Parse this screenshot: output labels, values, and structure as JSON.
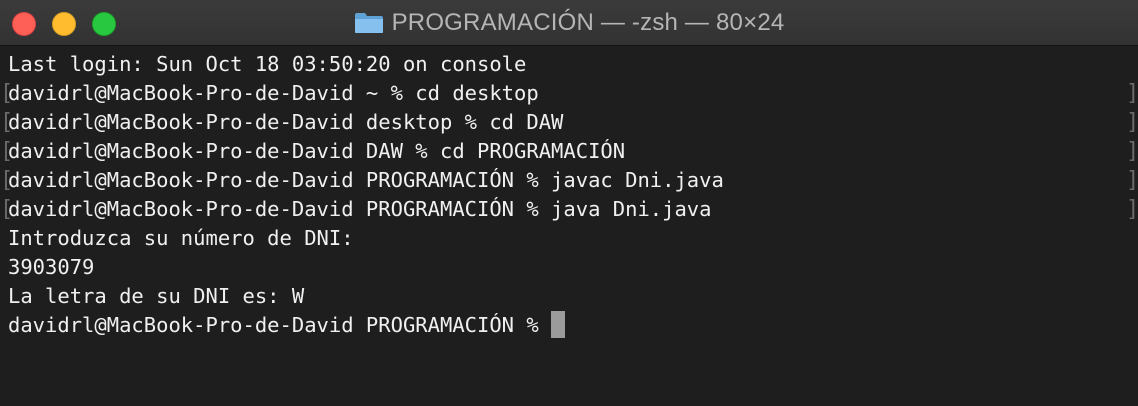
{
  "window": {
    "title": "PROGRAMACIÓN — -zsh — 80×24",
    "title_icon": "folder-icon",
    "controls": [
      "close",
      "minimize",
      "zoom"
    ],
    "colors": {
      "background": "#1e1e1e",
      "text": "#f0f0f0",
      "close": "#fe5f57",
      "minimize": "#febc2e",
      "zoom": "#28c840",
      "folder": "#79b8e8"
    }
  },
  "terminal": {
    "lines": [
      "Last login: Sun Oct 18 03:50:20 on console",
      "davidrl@MacBook-Pro-de-David ~ % cd desktop",
      "davidrl@MacBook-Pro-de-David desktop % cd DAW",
      "davidrl@MacBook-Pro-de-David DAW % cd PROGRAMACIÓN",
      "davidrl@MacBook-Pro-de-David PROGRAMACIÓN % javac Dni.java",
      "davidrl@MacBook-Pro-de-David PROGRAMACIÓN % java Dni.java",
      "Introduzca su número de DNI:",
      "3903079",
      "La letra de su DNI es: W",
      "davidrl@MacBook-Pro-de-David PROGRAMACIÓN % "
    ]
  }
}
